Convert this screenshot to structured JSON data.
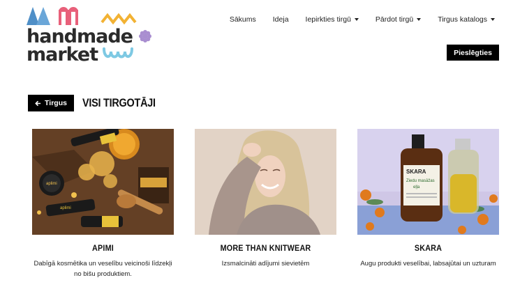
{
  "logo": {
    "line1": "handmade",
    "line2": "market"
  },
  "nav": {
    "items": [
      {
        "label": "Sākums",
        "has_dropdown": false
      },
      {
        "label": "Ideja",
        "has_dropdown": false
      },
      {
        "label": "Iepirkties tirgū",
        "has_dropdown": true
      },
      {
        "label": "Pārdot tirgū",
        "has_dropdown": true
      },
      {
        "label": "Tirgus katalogs",
        "has_dropdown": true
      }
    ],
    "login_label": "Pieslēgties"
  },
  "header": {
    "back_label": "Tirgus",
    "title": "VISI TIRGOTĀJI"
  },
  "cards": [
    {
      "name": "APIMI",
      "description": "Dabīgā kosmētika un veselību veicinoši līdzekļi no bišu produktiem."
    },
    {
      "name": "MORE THAN KNITWEAR",
      "description": "Izsmalcināti adījumi sievietēm"
    },
    {
      "name": "SKARA",
      "description": "Augu produkti veselībai, labsajūtai un uzturam"
    }
  ],
  "colors": {
    "accent_blue": "#5b9bd5",
    "accent_pink": "#e8607a",
    "accent_yellow": "#f2b233",
    "accent_purple": "#a98ed0",
    "accent_cyan": "#7ec9e3",
    "button_bg": "#000000"
  }
}
